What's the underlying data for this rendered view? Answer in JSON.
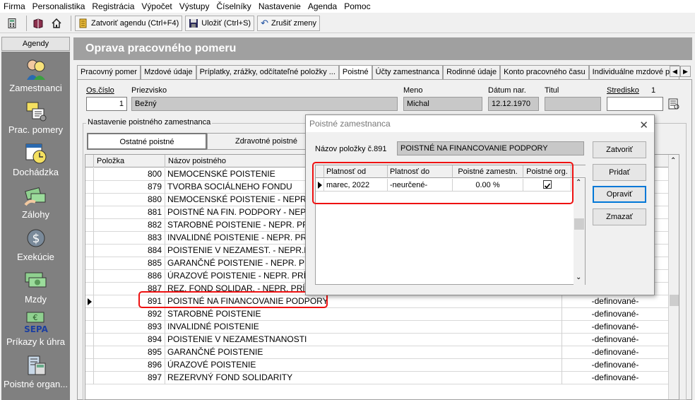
{
  "menu": [
    "Firma",
    "Personalistika",
    "Registrácia",
    "Výpočet",
    "Výstupy",
    "Číselníky",
    "Nastavenie",
    "Agenda",
    "Pomoc"
  ],
  "toolbar": {
    "close_agenda": "Zatvoriť agendu (Ctrl+F4)",
    "save": "Uložiť (Ctrl+S)",
    "cancel_changes": "Zrušiť zmeny"
  },
  "agenda": {
    "header": "Agendy",
    "items": [
      {
        "label": "Zamestnanci",
        "icon": "employees-icon"
      },
      {
        "label": "Prac. pomery",
        "icon": "work-contracts-icon"
      },
      {
        "label": "Dochádzka",
        "icon": "attendance-icon"
      },
      {
        "label": "Zálohy",
        "icon": "advances-icon"
      },
      {
        "label": "Exekúcie",
        "icon": "executions-icon"
      },
      {
        "label": "Mzdy",
        "icon": "wages-icon"
      },
      {
        "label": "Príkazy k úhra",
        "icon": "sepa-payments-icon"
      },
      {
        "label": "Poistné organ...",
        "icon": "insurance-org-icon"
      }
    ]
  },
  "window_title": "Oprava pracovného pomeru",
  "tabs": [
    {
      "label": "Pracovný pomer",
      "active": false
    },
    {
      "label": "Mzdové údaje",
      "active": false
    },
    {
      "label": "Príplatky, zrážky, odčítateľné položky ...",
      "active": false
    },
    {
      "label": "Poistné",
      "active": true
    },
    {
      "label": "Účty zamestnanca",
      "active": false
    },
    {
      "label": "Rodinné údaje",
      "active": false
    },
    {
      "label": "Konto pracovného času",
      "active": false
    },
    {
      "label": "Individuálne mzdové p...",
      "active": false
    }
  ],
  "employee": {
    "oscislo_label": "Os.číslo",
    "oscislo": "1",
    "priezvisko_label": "Priezvisko",
    "priezvisko": "Bežný",
    "meno_label": "Meno",
    "meno": "Michal",
    "datum_label": "Dátum nar.",
    "datum": "12.12.1970",
    "titul_label": "Titul",
    "titul": "",
    "stredisko_label": "Stredisko",
    "stredisko_value": "1",
    "stredisko": ""
  },
  "section": {
    "label": "Nastavenie poistného zamestnanca",
    "subtab_other": "Ostatné poistné",
    "subtab_health": "Zdravotné poistné"
  },
  "grid": {
    "headers": {
      "polozka": "Položka",
      "nazov": "Názov poistného"
    },
    "rows": [
      {
        "code": "800",
        "name": "NEMOCENSKÉ POISTENIE",
        "def": ""
      },
      {
        "code": "879",
        "name": "TVORBA SOCIÁLNEHO FONDU",
        "def": ""
      },
      {
        "code": "880",
        "name": "NEMOCENSKÉ POISTENIE - NEPR. PRÍ",
        "def": ""
      },
      {
        "code": "881",
        "name": "POISTNÉ NA FIN. PODPORY - NEPR. PR",
        "def": ""
      },
      {
        "code": "882",
        "name": "STAROBNÉ POISTENIE - NEPR. PRÍJEM",
        "def": ""
      },
      {
        "code": "883",
        "name": "INVALIDNÉ POISTENIE - NEPR. PRÍJEM",
        "def": ""
      },
      {
        "code": "884",
        "name": "POISTENIE V NEZAMEST. - NEPR.PRÍJ",
        "def": ""
      },
      {
        "code": "885",
        "name": "GARANČNÉ POISTENIE - NEPR. PRÍJEM",
        "def": ""
      },
      {
        "code": "886",
        "name": "ÚRAZOVÉ POISTENIE - NEPR. PRÍJEM",
        "def": ""
      },
      {
        "code": "887",
        "name": "REZ. FOND SOLIDAR. - NEPR. PRÍJEM",
        "def": ""
      },
      {
        "code": "891",
        "name": "POISTNÉ NA FINANCOVANIE PODPORY",
        "def": "-definované-"
      },
      {
        "code": "892",
        "name": "STAROBNÉ POISTENIE",
        "def": "-definované-"
      },
      {
        "code": "893",
        "name": "INVALIDNÉ POISTENIE",
        "def": "-definované-"
      },
      {
        "code": "894",
        "name": "POISTENIE V NEZAMESTNANOSTI",
        "def": "-definované-"
      },
      {
        "code": "895",
        "name": "GARANČNÉ POISTENIE",
        "def": "-definované-"
      },
      {
        "code": "896",
        "name": "ÚRAZOVÉ POISTENIE",
        "def": "-definované-"
      },
      {
        "code": "897",
        "name": "REZERVNÝ FOND SOLIDARITY",
        "def": "-definované-"
      }
    ],
    "selected_code": "891"
  },
  "dialog": {
    "title": "Poistné zamestnanca",
    "item_label": "Názov položky č.891",
    "item_name": "POISTNÉ NA FINANCOVANIE PODPORY",
    "headers": {
      "from": "Platnosť od",
      "to": "Platnosť do",
      "employee_pct": "Poistné  zamestn.",
      "org_pct": "Poistné org."
    },
    "rows": [
      {
        "from": "marec, 2022",
        "to": "-neurčené-",
        "employee_pct": "0.00 %",
        "org_checked": true
      }
    ],
    "buttons": {
      "close": "Zatvoriť",
      "add": "Pridať",
      "edit": "Opraviť",
      "delete": "Zmazať"
    }
  },
  "colors": {
    "highlight_red": "#e11111",
    "agenda_bg": "#808080",
    "title_band": "#a0a0a0"
  }
}
